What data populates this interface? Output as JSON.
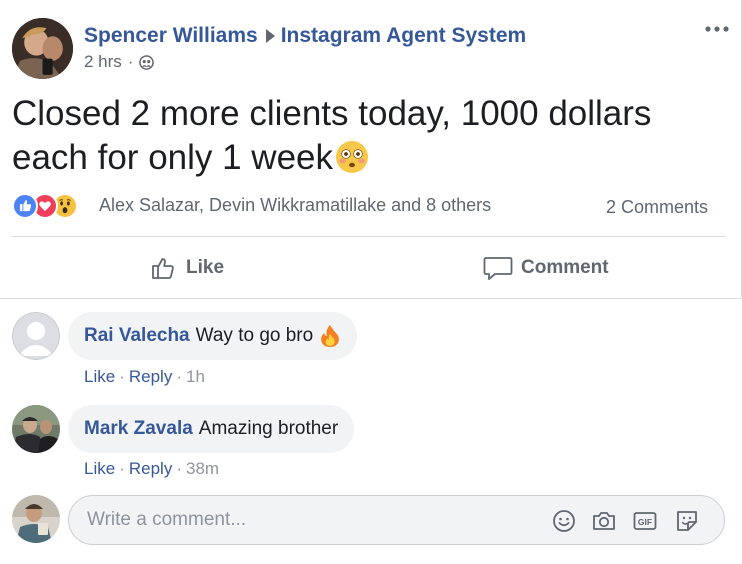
{
  "post": {
    "author": "Spencer Williams",
    "group": "Instagram Agent System",
    "time": "2 hrs",
    "privacy_icon": "friends-globe-icon",
    "more_icon": "more-options-icon",
    "text": "Closed 2 more clients today, 1000 dollars each for only 1 week",
    "text_emoji": "flushed-face-emoji"
  },
  "reactions": {
    "types": [
      "like",
      "love",
      "wow"
    ],
    "summary": "Alex Salazar, Devin Wikkramatillake and 8 others",
    "comments_count": "2 Comments"
  },
  "actions": {
    "like_label": "Like",
    "comment_label": "Comment"
  },
  "comments": [
    {
      "name": "Rai Valecha",
      "text": "Way to go bro",
      "emoji": "fire-emoji",
      "like": "Like",
      "reply": "Reply",
      "time": "1h"
    },
    {
      "name": "Mark Zavala",
      "text": "Amazing brother",
      "like": "Like",
      "reply": "Reply",
      "time": "38m"
    }
  ],
  "composer": {
    "placeholder": "Write a comment...",
    "tools": [
      "emoji-icon",
      "camera-icon",
      "gif-icon",
      "sticker-icon"
    ]
  },
  "colors": {
    "link": "#365899",
    "secondary_text": "#606770",
    "bubble_bg": "#f2f3f5",
    "like_blue": "#4d84f5",
    "love_red": "#ef3f5b",
    "wow_yellow": "#f7c23f"
  }
}
